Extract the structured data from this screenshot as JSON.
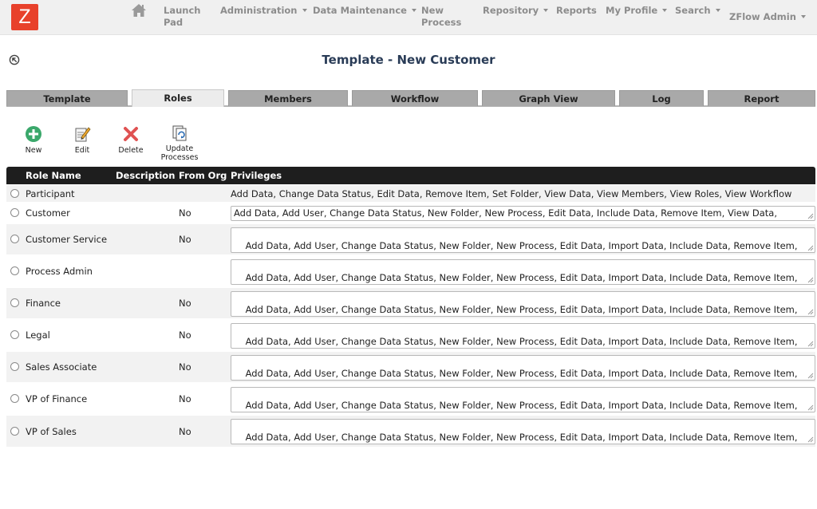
{
  "app": {
    "logo": "Z"
  },
  "nav": {
    "launch_pad": [
      "Launch",
      "Pad"
    ],
    "administration": "Administration",
    "data_maintenance": "Data Maintenance",
    "new_process": [
      "New",
      "Process"
    ],
    "repository": "Repository",
    "reports": "Reports",
    "my_profile": "My Profile",
    "search": "Search",
    "user": "ZFlow Admin"
  },
  "page": {
    "title": "Template - New Customer"
  },
  "tabs": [
    "Template",
    "Roles",
    "Members",
    "Workflow",
    "Graph View",
    "Log",
    "Report"
  ],
  "active_tab": "Roles",
  "toolbar": {
    "new": "New",
    "edit": "Edit",
    "delete": "Delete",
    "update": [
      "Update",
      "Processes"
    ]
  },
  "table": {
    "headers": [
      "Role Name",
      "Description",
      "From Org",
      "Privileges"
    ],
    "rows": [
      {
        "name": "Participant",
        "from_org": "",
        "privileges": "Add Data, Change Data Status, Edit Data, Remove Item, Set Folder, View Data, View Members, View Roles, View Workflow",
        "editable": false
      },
      {
        "name": "Customer",
        "from_org": "No",
        "privileges": "Add Data, Add User, Change Data Status, New Folder, New Process, Edit Data, Include Data, Remove Item, View Data,",
        "editable": true
      },
      {
        "name": "Customer Service",
        "from_org": "No",
        "privileges": "Add Data, Add User, Change Data Status, New Folder, New Process, Edit Data, Import Data, Include Data, Remove Item,\nRevise, Select Version, Set Folder, View Data, View Members, View Roles, View Workflow",
        "editable": true
      },
      {
        "name": "Process Admin",
        "from_org": "",
        "privileges": "Add Data, Add User, Change Data Status, New Folder, New Process, Edit Data, Import Data, Include Data, Remove Item,\nRevise, Select Version, Set Folder, View Data, View Members, View Roles, View Workflow",
        "editable": true
      },
      {
        "name": "Finance",
        "from_org": "No",
        "privileges": "Add Data, Add User, Change Data Status, New Folder, New Process, Edit Data, Import Data, Include Data, Remove Item,\nRevise, Select Version, Set Folder, View Data, View Members, View Roles, View Workflow",
        "editable": true
      },
      {
        "name": "Legal",
        "from_org": "No",
        "privileges": "Add Data, Add User, Change Data Status, New Folder, New Process, Edit Data, Import Data, Include Data, Remove Item,\nRevise, Select Version, Set Folder, View Data, View Members, View Roles, View Workflow",
        "editable": true
      },
      {
        "name": "Sales Associate",
        "from_org": "No",
        "privileges": "Add Data, Add User, Change Data Status, New Folder, New Process, Edit Data, Import Data, Include Data, Remove Item,\nRevise, Select Version, Set Folder, View Data, View Members, View Roles, View Workflow",
        "editable": true
      },
      {
        "name": "VP of Finance",
        "from_org": "No",
        "privileges": "Add Data, Add User, Change Data Status, New Folder, New Process, Edit Data, Import Data, Include Data, Remove Item,\nRevise, Select Version, Set Folder, View Data, View Members, View Roles, View Workflow",
        "editable": true
      },
      {
        "name": "VP of Sales",
        "from_org": "No",
        "privileges": "Add Data, Add User, Change Data Status, New Folder, New Process, Edit Data, Import Data, Include Data, Remove Item,\nRevise, Select Version, Set Folder, View Data, View Members, View Roles, View Workflow",
        "editable": true
      }
    ]
  },
  "colors": {
    "logo": "#e8412b",
    "title": "#2a3c57",
    "header_bg": "#1e1e1e",
    "nav_text": "#8c8c8c",
    "new_icon": "#3aa86b",
    "delete_icon": "#e05252"
  }
}
